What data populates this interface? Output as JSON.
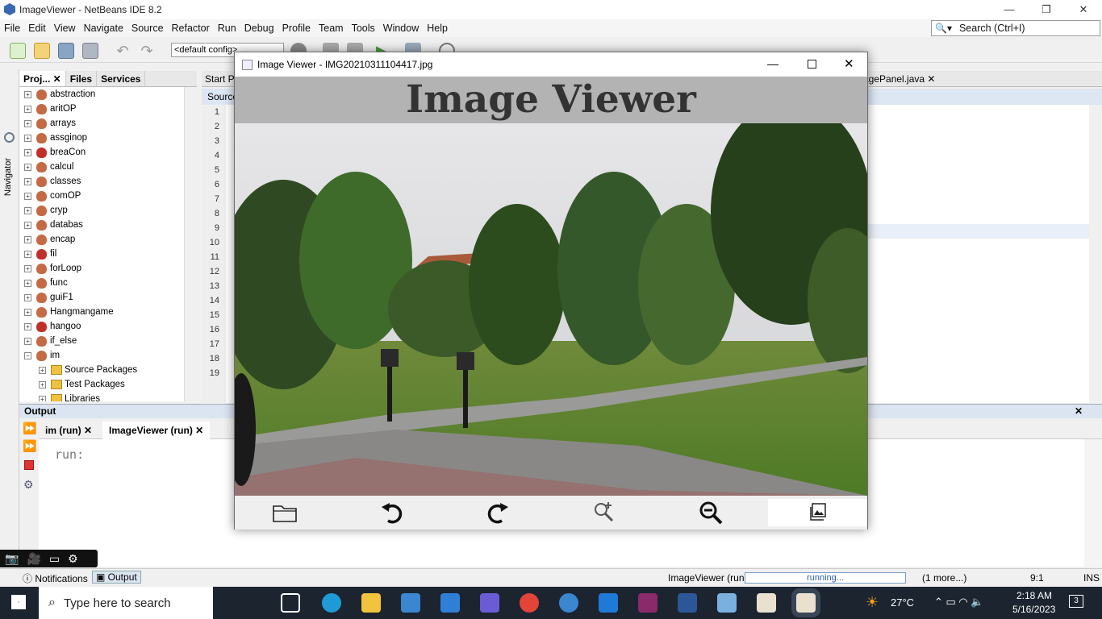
{
  "ide": {
    "title": "ImageViewer - NetBeans IDE 8.2",
    "menu": [
      "File",
      "Edit",
      "View",
      "Navigate",
      "Source",
      "Refactor",
      "Run",
      "Debug",
      "Profile",
      "Team",
      "Tools",
      "Window",
      "Help"
    ],
    "search_placeholder": "Search (Ctrl+I)",
    "config_value": "<default config>",
    "navigator_label": "Navigator"
  },
  "projects": {
    "tabs": [
      "Proj...",
      "Files",
      "Services"
    ],
    "items": [
      "abstraction",
      "aritOP",
      "arrays",
      "assginop",
      "breaCon",
      "calcul",
      "classes",
      "comOP",
      "cryp",
      "databas",
      "encap",
      "fil",
      "forLoop",
      "func",
      "guiF1",
      "Hangmangame",
      "hangoo",
      "if_else",
      "im"
    ],
    "error_items": [
      4,
      11,
      16
    ],
    "subitems": [
      "Source Packages",
      "Test Packages",
      "Libraries"
    ]
  },
  "editor": {
    "tabs": [
      "Start P",
      "agePanel.java"
    ],
    "subtab": "Source",
    "line_numbers": [
      "1",
      "2",
      "3",
      "4",
      "5",
      "6",
      "7",
      "8",
      "9",
      "10",
      "11",
      "12",
      "13",
      "14",
      "15",
      "16",
      "17",
      "18",
      "19"
    ]
  },
  "output": {
    "header": "Output",
    "tabs": [
      "im (run)",
      "ImageViewer (run)"
    ],
    "body": "run:"
  },
  "status": {
    "notifications": "Notifications",
    "output": "Output",
    "task": "ImageViewer (run)",
    "progress": "running...",
    "more": "(1 more...)",
    "position": "9:1",
    "mode": "INS"
  },
  "taskbar": {
    "search_placeholder": "Type here to search",
    "weather": "27°C",
    "time": "2:18 AM",
    "date": "5/16/2023",
    "notif_count": "3"
  },
  "image_viewer": {
    "title": "Image Viewer - IMG20210311104417.jpg",
    "heading": "Image Viewer",
    "buttons": [
      "open-folder",
      "rotate-left",
      "rotate-right",
      "zoom-in",
      "zoom-out",
      "gallery"
    ]
  },
  "colors": {
    "accent": "#2a5fb0",
    "heading_bar": "#b3b3b3",
    "taskbar": "#1c2430"
  }
}
